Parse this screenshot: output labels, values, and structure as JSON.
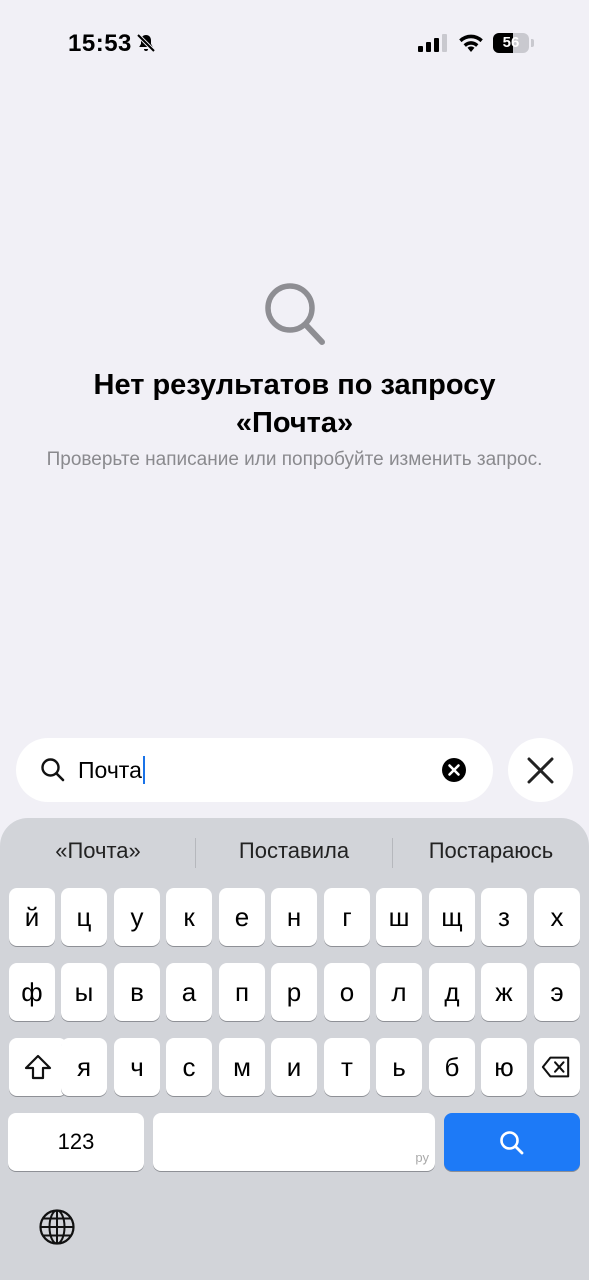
{
  "status_bar": {
    "time": "15:53",
    "battery": "56",
    "battery_level": 0.56,
    "icons": [
      "bell-slash-icon",
      "cellular-signal-icon",
      "wifi-icon",
      "battery-icon"
    ]
  },
  "empty_state": {
    "icon": "search-icon",
    "title": "Нет результатов по запросу «Почта»",
    "subtitle": "Проверьте написание или попробуйте изменить запрос."
  },
  "search": {
    "value": "Почта",
    "icon": "search-icon",
    "clear_icon": "clear-icon",
    "close_icon": "close-icon"
  },
  "keyboard": {
    "suggestions": [
      "«Почта»",
      "Поставила",
      "Постараюсь"
    ],
    "row1": [
      "й",
      "ц",
      "у",
      "к",
      "е",
      "н",
      "г",
      "ш",
      "щ",
      "з",
      "х"
    ],
    "row2": [
      "ф",
      "ы",
      "в",
      "а",
      "п",
      "р",
      "о",
      "л",
      "д",
      "ж",
      "э"
    ],
    "row3": [
      "я",
      "ч",
      "с",
      "м",
      "и",
      "т",
      "ь",
      "б",
      "ю"
    ],
    "numbers_label": "123",
    "space_lang": "ру",
    "icons": [
      "shift-icon",
      "backspace-icon",
      "search-icon",
      "globe-icon"
    ]
  },
  "colors": {
    "background": "#f1f0f6",
    "accent": "#1d7af7",
    "keyboard_bg": "#d2d4d9",
    "secondary_text": "#8a8a8e"
  }
}
